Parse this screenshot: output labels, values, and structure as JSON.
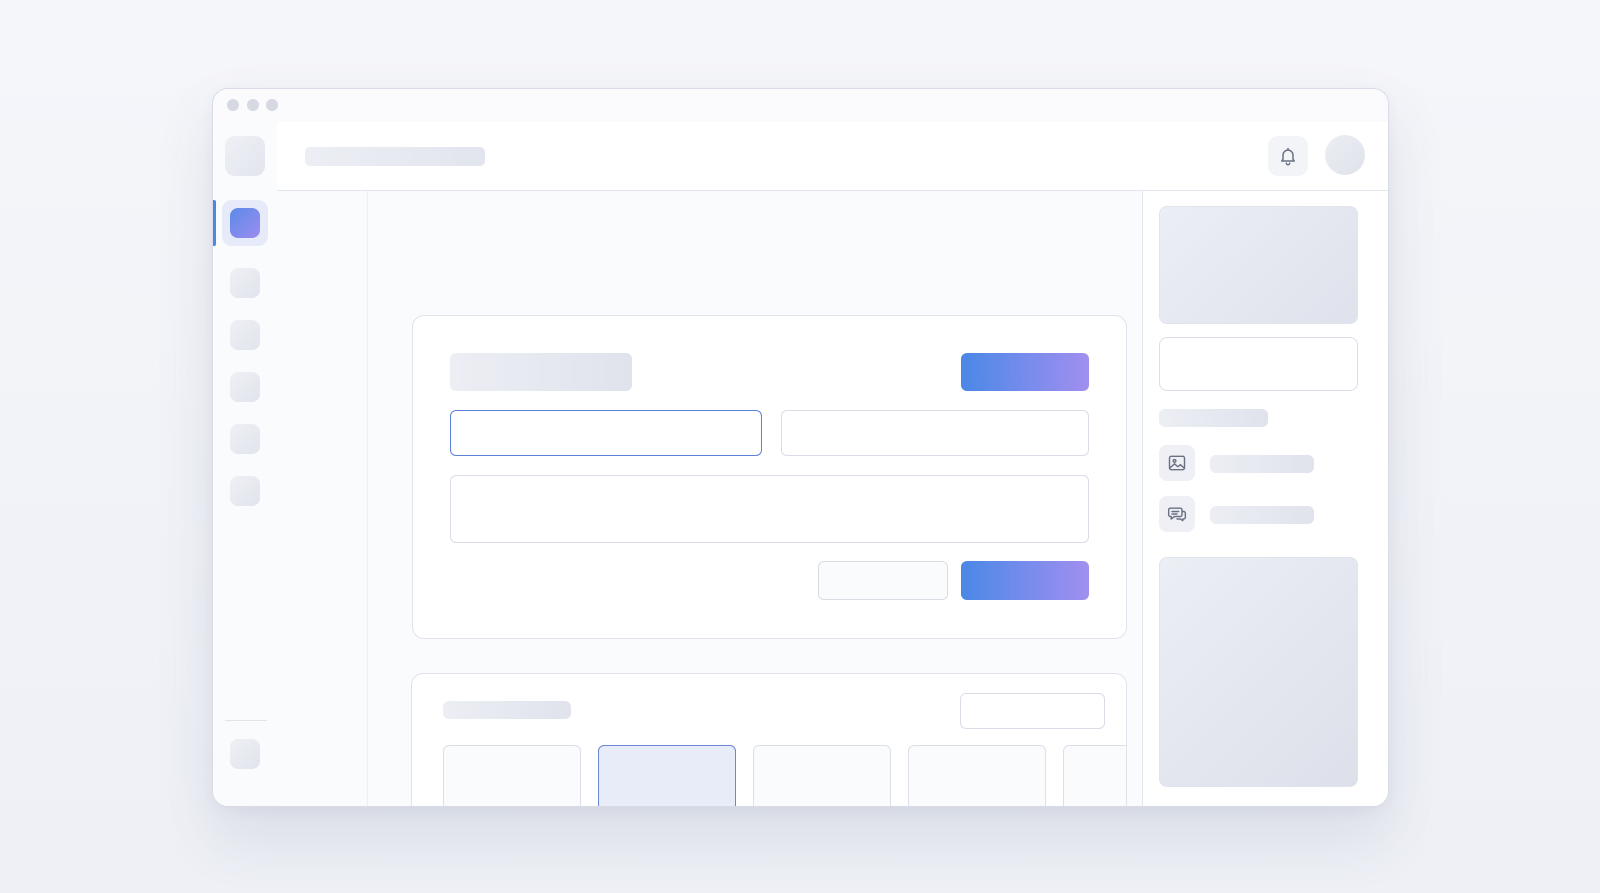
{
  "window": {
    "traffic_lights": [
      "close",
      "minimize",
      "maximize"
    ]
  },
  "sidebar": {
    "logo_icon": "app-logo-icon",
    "active_item_icon": "active-nav-icon",
    "items": [
      "nav-item-1",
      "nav-item-2",
      "nav-item-3",
      "nav-item-4",
      "nav-item-5"
    ],
    "footer_icon": "settings-icon",
    "accent_color": "#4a88e6"
  },
  "topbar": {
    "notification_icon": "bell-icon",
    "avatar_icon": "avatar-icon"
  },
  "form_card": {
    "first_field": {
      "value": "",
      "placeholder": ""
    },
    "second_field": {
      "value": "",
      "placeholder": ""
    },
    "textarea_field": {
      "value": "",
      "placeholder": ""
    }
  },
  "gallery_card": {
    "tiles": [
      "tile-1",
      "tile-2",
      "tile-3",
      "tile-4",
      "tile-5"
    ],
    "selected_tile_index": 1
  },
  "right_panel": {
    "list_items": [
      {
        "icon": "image-icon"
      },
      {
        "icon": "chat-icon"
      }
    ]
  },
  "colors": {
    "primary_gradient_start": "#4a88e6",
    "primary_gradient_end": "#a18ff0",
    "focus_border": "#5c83d9"
  }
}
